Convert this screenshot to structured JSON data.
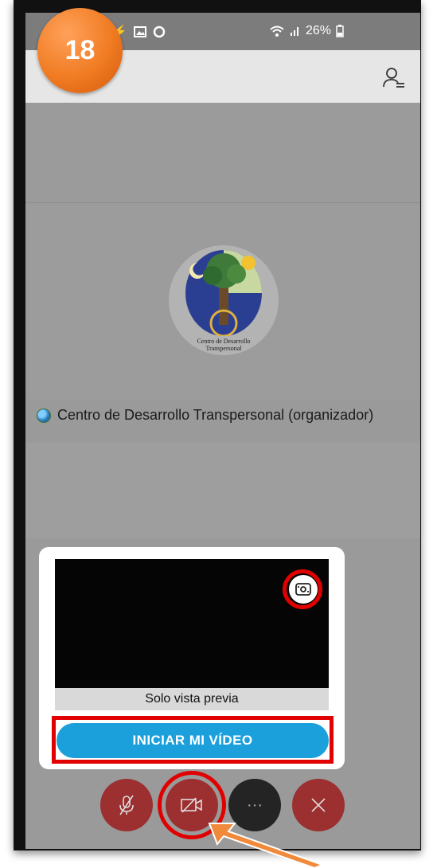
{
  "tutorial": {
    "step_number": "18"
  },
  "status_bar": {
    "battery": "26%"
  },
  "meeting": {
    "organizer_label": "Centro de Desarrollo Transpersonal (organizador)",
    "logo_text_line1": "Centro de Desarrollo",
    "logo_text_line2": "Transpersonal"
  },
  "preview": {
    "caption": "Solo vista previa",
    "start_video_label": "INICIAR MI VÍDEO"
  },
  "controls": {
    "mic_icon": "mic-off-icon",
    "video_icon": "video-off-icon",
    "more_label": "···",
    "leave_icon": "close-icon"
  },
  "colors": {
    "accent_blue": "#1ba0dc",
    "control_red": "#9c2f2f",
    "highlight_red": "#e10000",
    "badge_orange": "#f07b22"
  }
}
